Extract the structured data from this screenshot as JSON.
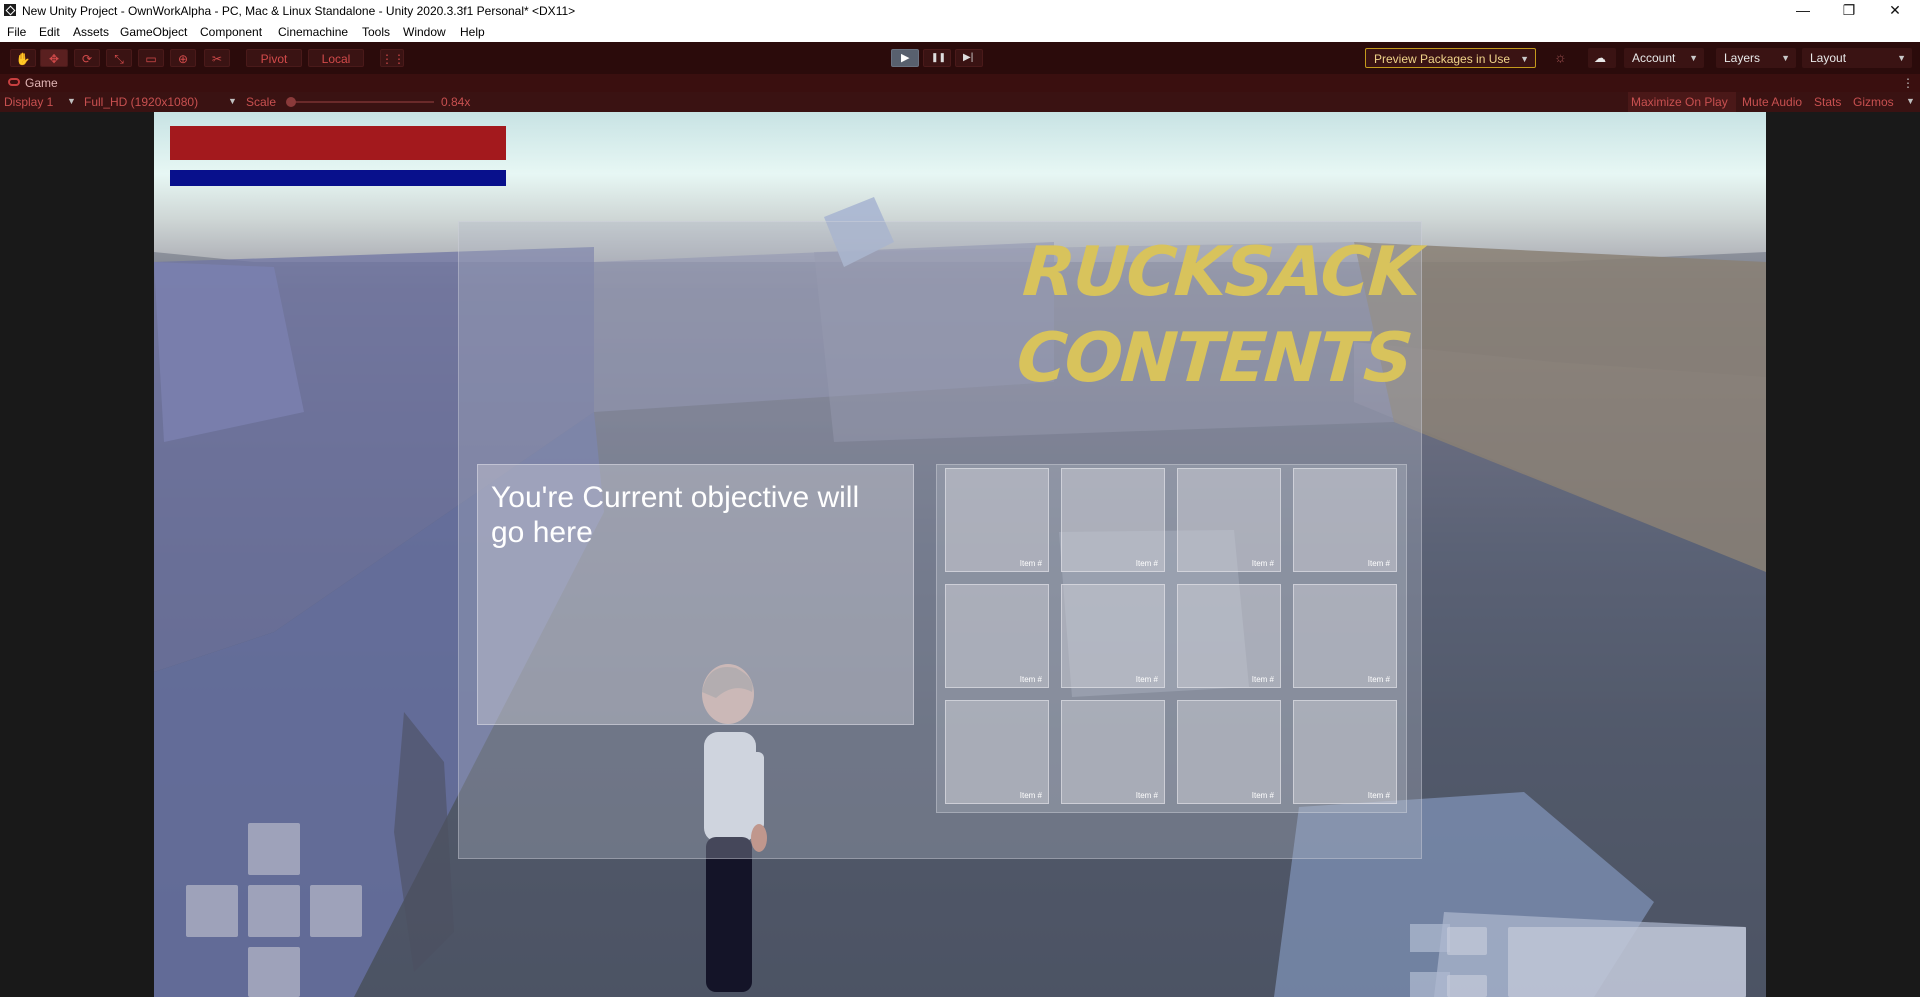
{
  "window": {
    "title": "New Unity Project - OwnWorkAlpha - PC, Mac & Linux Standalone - Unity 2020.3.3f1 Personal* <DX11>",
    "minimize": "—",
    "restore": "❐",
    "close": "✕"
  },
  "menu": [
    "File",
    "Edit",
    "Assets",
    "GameObject",
    "Component",
    "Cinemachine",
    "Tools",
    "Window",
    "Help"
  ],
  "toolbar": {
    "tools": [
      {
        "icon": "hand-icon",
        "glyph": "✋"
      },
      {
        "icon": "move-icon",
        "glyph": "✥"
      },
      {
        "icon": "rotate-icon",
        "glyph": "⟳"
      },
      {
        "icon": "scale-icon",
        "glyph": "⤡"
      },
      {
        "icon": "rect-icon",
        "glyph": "▭"
      },
      {
        "icon": "transform-icon",
        "glyph": "⊕"
      },
      {
        "icon": "custom-tool-icon",
        "glyph": "✂"
      }
    ],
    "pivot": "Pivot",
    "local": "Local",
    "grid_icon": "⋮⋮",
    "play_glyph": "▶",
    "pause_glyph": "❚❚",
    "step_glyph": "▶|",
    "preview_packages": "Preview Packages in Use",
    "settings_glyph": "☼",
    "cloud_glyph": "☁",
    "account": "Account",
    "layers": "Layers",
    "layout": "Layout",
    "caret": "▼"
  },
  "game_tab": {
    "label": "Game",
    "icon": "gamepad-icon",
    "menu_glyph": "⋮"
  },
  "game_bar": {
    "display": "Display 1",
    "resolution": "Full_HD (1920x1080)",
    "scale_label": "Scale",
    "scale_value": "0.84x",
    "maximize_on_play": "Maximize On Play",
    "mute_audio": "Mute Audio",
    "stats": "Stats",
    "gizmos": "Gizmos",
    "caret": "▼"
  },
  "hud": {
    "health_color": "#a3191d",
    "stamina_color": "#08108c"
  },
  "rucksack": {
    "title_line1": "RUCKSACK",
    "title_line2": "CONTENTS",
    "objective": "You're Current objective will go here",
    "slot_label": "Item #"
  }
}
